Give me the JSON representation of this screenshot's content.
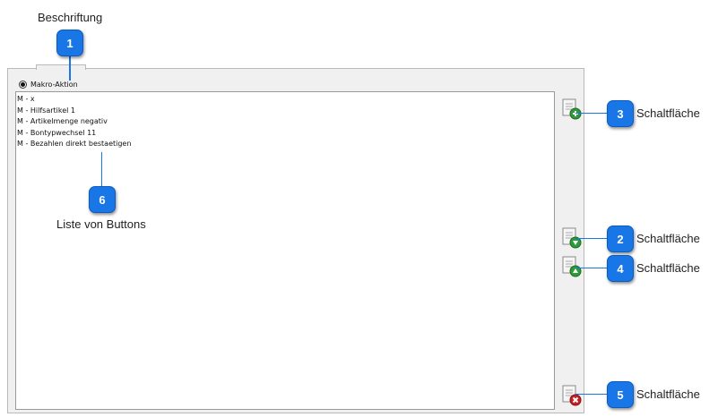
{
  "annotations": {
    "caption_label": "Beschriftung",
    "list_label": "Liste von Buttons",
    "callouts": [
      {
        "number": "1"
      },
      {
        "number": "2",
        "text": "Schaltfläche"
      },
      {
        "number": "3",
        "text": "Schaltfläche"
      },
      {
        "number": "4",
        "text": "Schaltfläche"
      },
      {
        "number": "5",
        "text": "Schaltfläche"
      },
      {
        "number": "6"
      }
    ]
  },
  "panel": {
    "radio_label": "Makro-Aktion",
    "radio_selected": true,
    "items": [
      "M - x",
      "M - Hilfsartikel 1",
      "M - Artikelmenge negativ",
      "M - Bontypwechsel 11",
      "M - Bezahlen direkt bestaetigen"
    ]
  },
  "buttons": {
    "add_icon": "add-document-icon",
    "down_icon": "move-down-icon",
    "up_icon": "move-up-icon",
    "delete_icon": "delete-document-icon"
  }
}
